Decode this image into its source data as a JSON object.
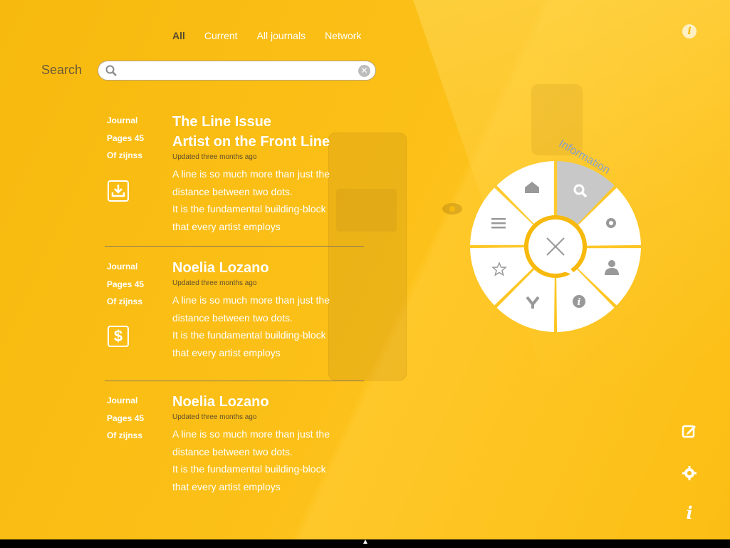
{
  "tabs": [
    {
      "label": "All",
      "active": true
    },
    {
      "label": "Current",
      "active": false
    },
    {
      "label": "All journals",
      "active": false
    },
    {
      "label": "Network",
      "active": false
    }
  ],
  "search": {
    "label": "Search",
    "value": "",
    "placeholder": ""
  },
  "entries": [
    {
      "meta": [
        "Journal",
        "Pages 45",
        "Of zijnss"
      ],
      "title_lines": [
        "The Line Issue",
        "Artist on the Front Line"
      ],
      "updated": "Updated three months ago",
      "desc": [
        "A line is so much more than just the",
        "distance between two dots.",
        "It is the fundamental building-block",
        "that every artist employs"
      ],
      "icon": "download-icon"
    },
    {
      "meta": [
        "Journal",
        "Pages 45",
        "Of zijnss"
      ],
      "title_lines": [
        "Noelia Lozano"
      ],
      "updated": "Updated three months ago",
      "desc": [
        "A line is so much more than just the",
        "distance between two dots.",
        "It is the fundamental building-block",
        "that every artist employs"
      ],
      "icon": "dollar-icon"
    },
    {
      "meta": [
        "Journal",
        "Pages 45",
        "Of zijnss"
      ],
      "title_lines": [
        "Noelia Lozano"
      ],
      "updated": "Updated three months ago",
      "desc": [
        "A line is so much more than just the",
        "distance between two dots.",
        "It is the fundamental building-block",
        "that every artist employs"
      ],
      "icon": ""
    }
  ],
  "radial_menu": {
    "label": "Information",
    "segments": [
      "search-icon",
      "gear-icon",
      "user-icon",
      "info-icon",
      "share-icon",
      "star-icon",
      "menu-icon",
      "home-icon"
    ],
    "active_segment": "search-icon",
    "center": "close-icon"
  },
  "side_icons": [
    "info-icon",
    "edit-icon",
    "gear-icon",
    "info-italic-icon"
  ],
  "colors": {
    "background": "#f7b90d",
    "accent_text": "#5a4a30",
    "active_segment": "#c8c8c8"
  }
}
